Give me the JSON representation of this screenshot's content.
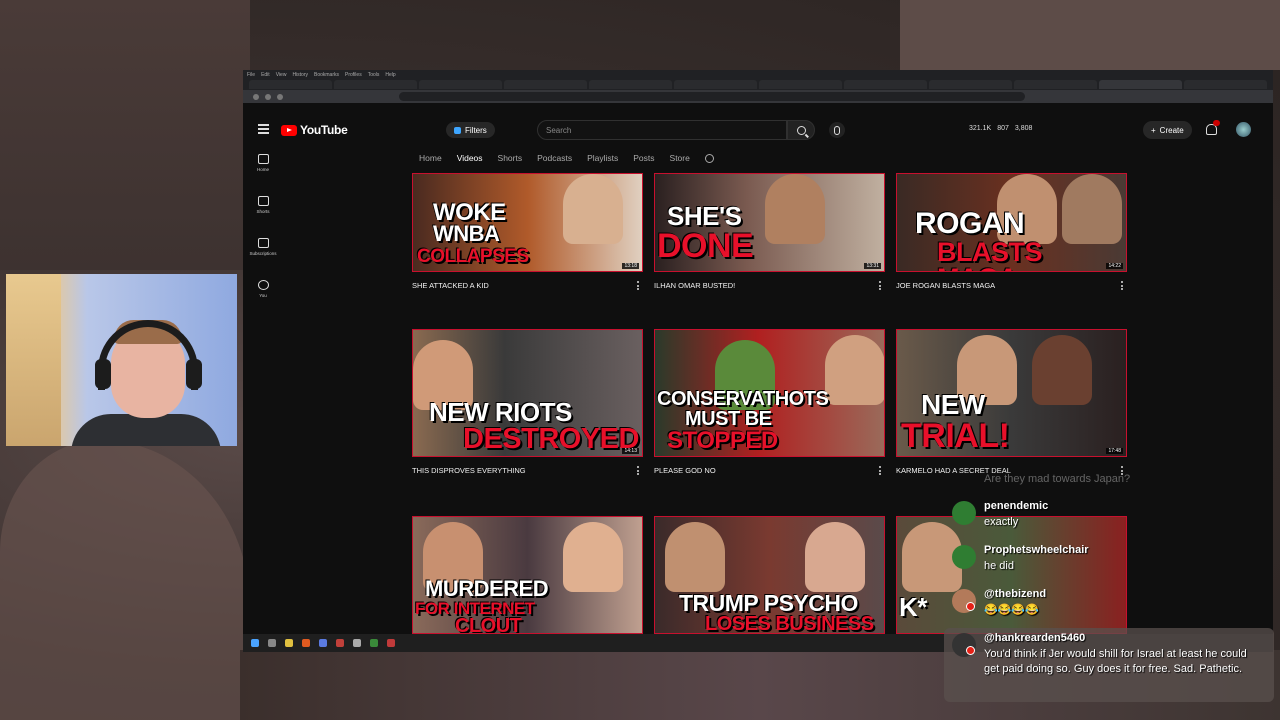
{
  "browser": {
    "menu": [
      "File",
      "Edit",
      "View",
      "History",
      "Bookmarks",
      "Profiles",
      "Tools",
      "Help"
    ],
    "tabs": [
      "",
      "",
      "",
      "",
      "",
      "",
      "",
      "",
      "",
      "",
      "",
      "",
      "",
      ""
    ],
    "url": ""
  },
  "youtube": {
    "logo_text": "YouTube",
    "filters_label": "Filters",
    "search_placeholder": "Search",
    "stats": [
      "321.1K",
      "807",
      "3,808"
    ],
    "create_label": "Create",
    "notification_count": "",
    "guide": [
      "Home",
      "Shorts",
      "Subscriptions",
      "You"
    ],
    "channel_tabs": [
      "Home",
      "Videos",
      "Shorts",
      "Podcasts",
      "Playlists",
      "Posts",
      "Store"
    ],
    "active_tab": "Videos"
  },
  "videos": [
    {
      "title": "SHE ATTACKED A KID",
      "caption_top": "WOKE",
      "caption_mid": "WNBA",
      "caption_bot": "COLLAPSES",
      "duration": "13:18",
      "meta": "",
      "chips": [
        "",
        ""
      ]
    },
    {
      "title": "ILHAN OMAR BUSTED!",
      "caption_top": "SHE'S",
      "caption_mid": "DONE",
      "caption_bot": "",
      "duration": "13:31",
      "meta": "",
      "chips": [
        "",
        ""
      ]
    },
    {
      "title": "JOE ROGAN BLASTS MAGA",
      "caption_top": "ROGAN",
      "caption_mid": "BLASTS MAGA",
      "caption_bot": "",
      "duration": "14:22",
      "meta": "",
      "chips": [
        ""
      ]
    },
    {
      "title": "THIS DISPROVES EVERYTHING",
      "caption_top": "NEW RIOTS",
      "caption_mid": "DESTROYED",
      "caption_bot": "",
      "duration": "14:13",
      "meta": "",
      "chips": [
        "",
        ""
      ]
    },
    {
      "title": "PLEASE GOD NO",
      "caption_top": "CONSERVATHOTS",
      "caption_mid": "MUST BE",
      "caption_bot": "STOPPED",
      "duration": "",
      "meta": "",
      "chips": [
        ""
      ]
    },
    {
      "title": "KARMELO HAD A SECRET DEAL",
      "caption_top": "NEW",
      "caption_mid": "TRIAL!",
      "caption_bot": "",
      "duration": "17:48",
      "meta": "",
      "chips": [
        "",
        ""
      ]
    },
    {
      "title": "",
      "caption_top": "MURDERED",
      "caption_mid": "FOR INTERNET",
      "caption_bot": "CLOUT",
      "duration": "",
      "meta": "",
      "chips": []
    },
    {
      "title": "",
      "caption_top": "TRUMP PSYCHO",
      "caption_mid": "LOSES BUSINESS",
      "caption_bot": "",
      "duration": "",
      "meta": "",
      "chips": []
    },
    {
      "title": "",
      "caption_top": "K*",
      "caption_mid": "",
      "caption_bot": "",
      "duration": "",
      "meta": "",
      "chips": []
    }
  ],
  "chat": {
    "ghost": "Are they mad towards Japan?",
    "messages": [
      {
        "user": "penendemic",
        "text": "exactly",
        "avatar": "#2f7d32"
      },
      {
        "user": "Prophetswheelchair",
        "text": "he did",
        "avatar": "#2f7d32"
      },
      {
        "user": "@thebizend",
        "text": "😂😂😂😂",
        "avatar": "#b37a5a"
      },
      {
        "user": "@hankrearden5460",
        "text": "You'd think if Jer would shill for Israel at least he could get paid doing so. Guy does it for free. Sad. Pathetic.",
        "avatar": "#333333"
      }
    ]
  },
  "colors": {
    "accent": "#ff0000",
    "thumb_border": "#c8102e",
    "caption_red": "#e8102a"
  }
}
